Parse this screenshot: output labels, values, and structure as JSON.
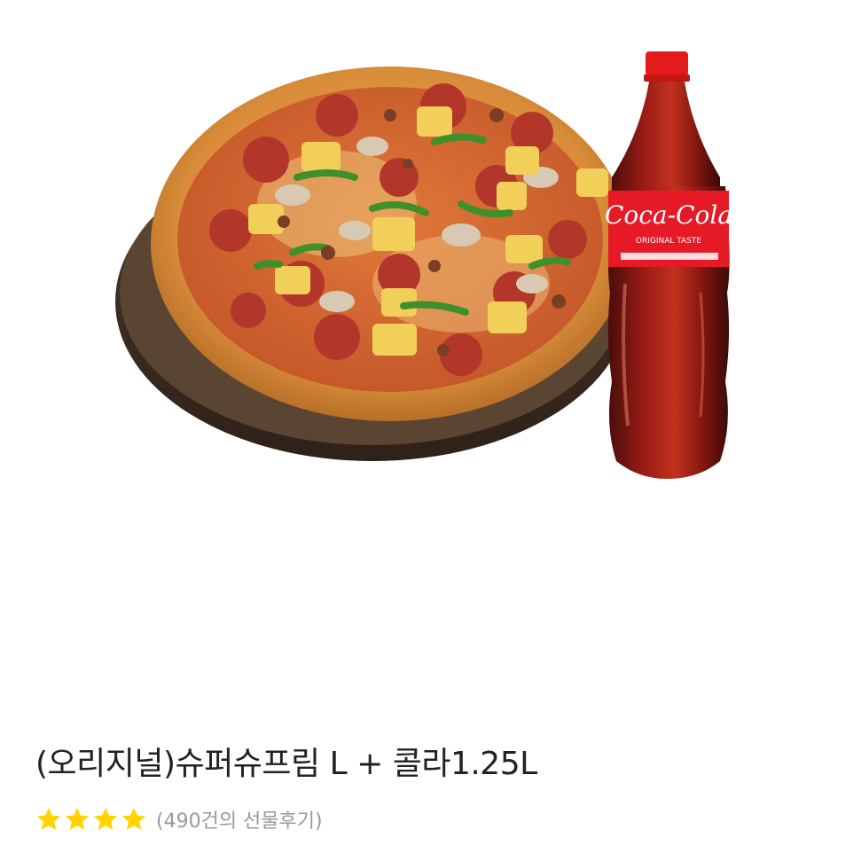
{
  "product": {
    "title": "(오리지널)슈퍼슈프림 L + 콜라1.25L",
    "rating_stars": 4,
    "review_count_text": "(490건의 선물후기)",
    "bottle_brand": "Coca-Cola",
    "bottle_subtitle": "ORIGINAL TASTE"
  },
  "colors": {
    "star": "#FFD400",
    "title": "#222222",
    "review_text": "#999999",
    "coke_red": "#E61A27"
  }
}
